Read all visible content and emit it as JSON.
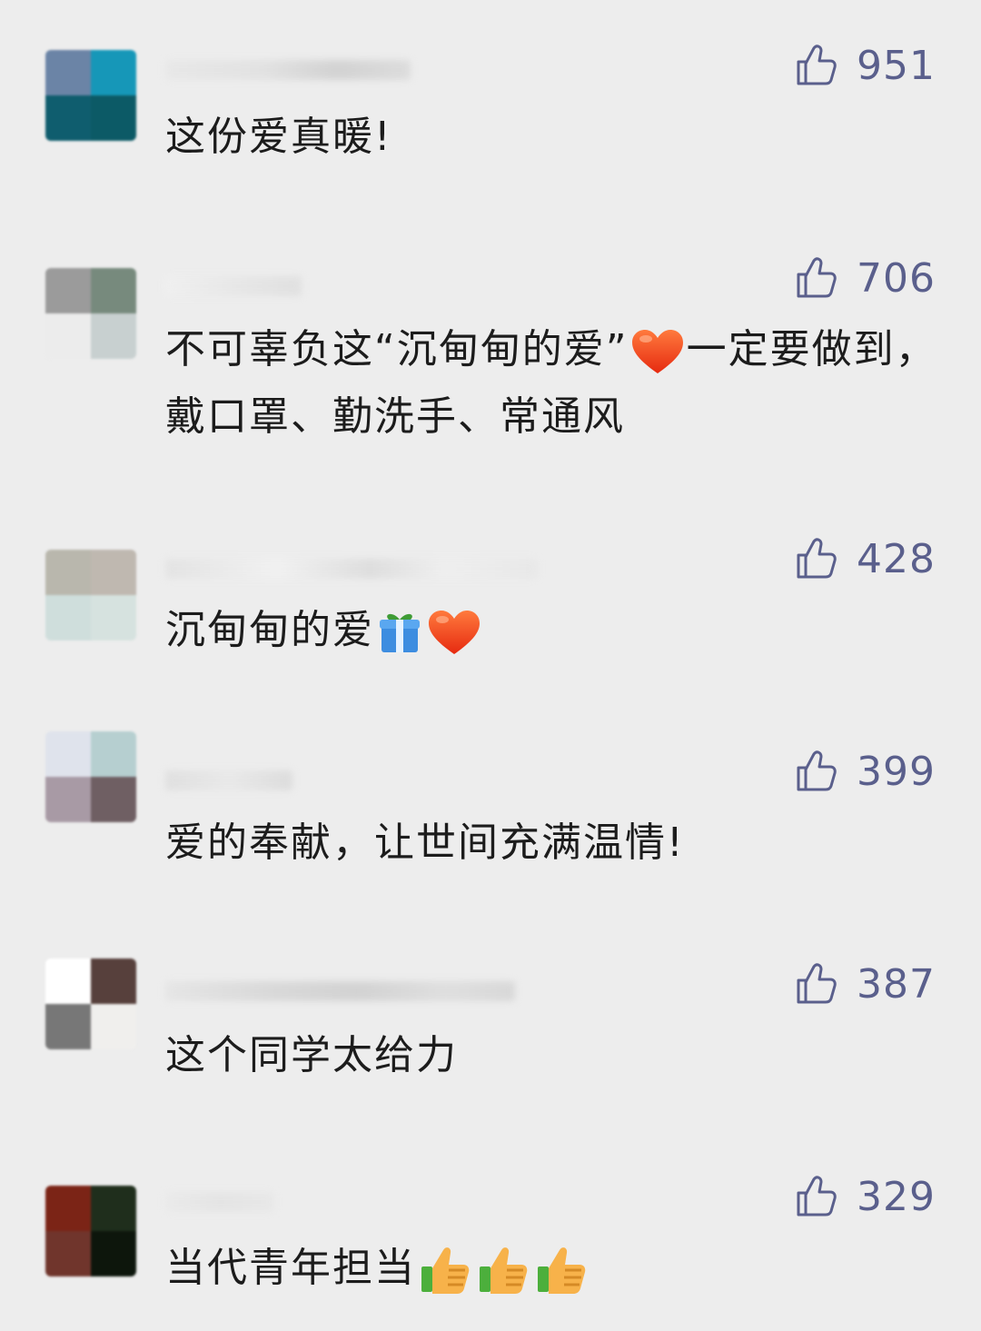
{
  "comments": [
    {
      "likes": "951",
      "text": "这份爱真暖!",
      "avatar_colors": [
        "#6b84a6",
        "#1697b8",
        "#0f5d6e",
        "#0c5a66"
      ],
      "emojis": []
    },
    {
      "likes": "706",
      "text": "不可辜负这“沉甸甸的爱”",
      "text_after": "一定要做到，戴口罩、勤洗手、常通风",
      "avatar_colors": [
        "#9b9b9b",
        "#778a7d",
        "#ececec",
        "#c8d0d0"
      ],
      "emojis": [
        "heart-emoji"
      ]
    },
    {
      "likes": "428",
      "text": "沉甸甸的爱",
      "avatar_colors": [
        "#b9b7ad",
        "#bfb8b0",
        "#cfdedc",
        "#d6e2df"
      ],
      "emojis": [
        "gift-emoji",
        "heart-emoji"
      ]
    },
    {
      "likes": "399",
      "text": "爱的奉献，让世间充满温情!",
      "avatar_colors": [
        "#dfe3ec",
        "#b6cfd0",
        "#a89aa5",
        "#6f5f63"
      ],
      "emojis": []
    },
    {
      "likes": "387",
      "text": "这个同学太给力",
      "avatar_colors": [
        "#ffffff",
        "#57403c",
        "#777777",
        "#f0efed"
      ],
      "emojis": []
    },
    {
      "likes": "329",
      "text": "当代青年担当",
      "avatar_colors": [
        "#7b2416",
        "#1f2e1c",
        "#70352c",
        "#0d160c"
      ],
      "emojis": [
        "thumbs-up-emoji",
        "thumbs-up-emoji",
        "thumbs-up-emoji"
      ]
    }
  ],
  "colors": {
    "background": "#ededed",
    "like_accent": "#5a5f8c",
    "text": "#1c1c1c"
  },
  "icons": {
    "like": "thumbs-up-outline-icon"
  }
}
